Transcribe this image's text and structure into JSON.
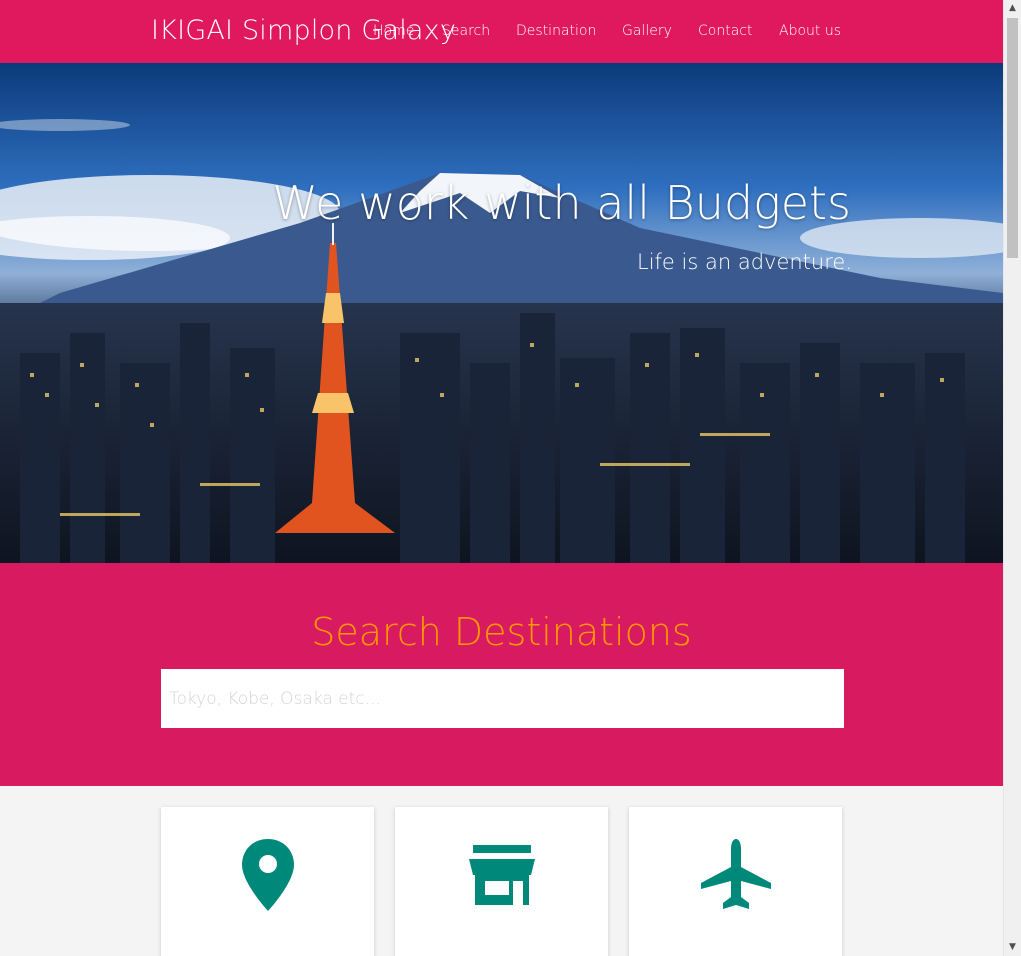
{
  "navbar": {
    "brand": "IKIGAI Simplon Galaxy",
    "links": [
      "Home",
      "Search",
      "Destination",
      "Gallery",
      "Contact",
      "About us"
    ],
    "color": "#e0195f"
  },
  "hero": {
    "title": "We work with all Budgets",
    "subtitle": "Life is an adventure."
  },
  "search": {
    "title": "Search Destinations",
    "placeholder": "Tokyo, Kobe, Osaka etc...",
    "value": "",
    "background": "#d81b60",
    "title_color": "#ff9800"
  },
  "cards": [
    {
      "icon": "map-marker-icon",
      "label": ""
    },
    {
      "icon": "store-icon",
      "label": ""
    },
    {
      "icon": "airplane-icon",
      "label": ""
    }
  ],
  "accent": "#00897b"
}
